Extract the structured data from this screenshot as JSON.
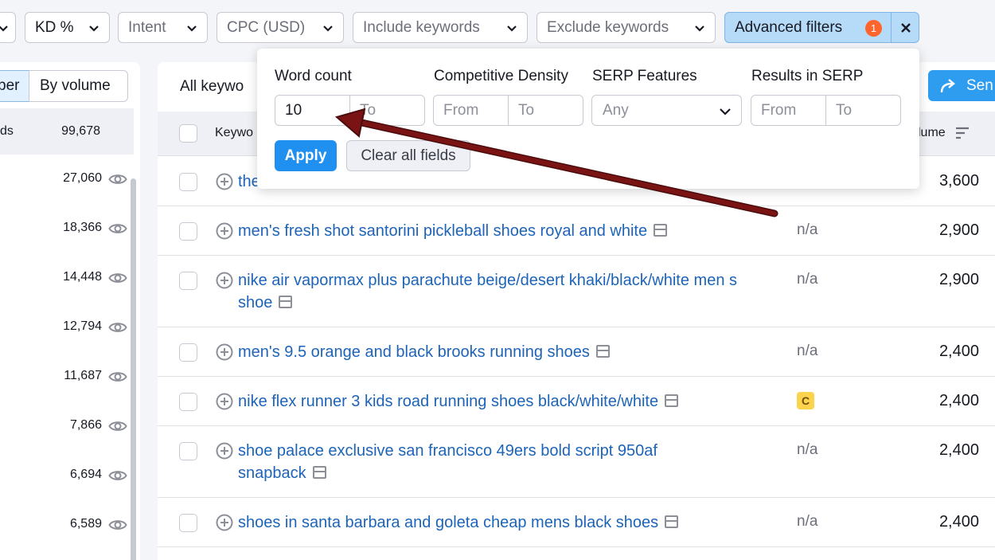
{
  "filters": {
    "partial": "",
    "kd": "KD %",
    "intent": "Intent",
    "cpc": "CPC (USD)",
    "include": "Include keywords",
    "exclude": "Exclude keywords",
    "advanced": "Advanced filters",
    "advanced_count": "1"
  },
  "left_panel": {
    "seg_a": "ber",
    "seg_b": "By volume",
    "header_label": "ds",
    "header_count": "99,678",
    "counts": [
      "27,060",
      "18,366",
      "14,448",
      "12,794",
      "11,687",
      "7,866",
      "6,694",
      "6,589"
    ]
  },
  "main": {
    "tab_label": "All keywo",
    "send_label": "Sen",
    "col_keyword": "Keywo",
    "col_volume": "lume"
  },
  "rows": [
    {
      "keyword": "the",
      "intent": "",
      "volume": "3,600"
    },
    {
      "keyword": "men's fresh shot santorini pickleball shoes royal and white",
      "intent": "n/a",
      "volume": "2,900"
    },
    {
      "keyword": "nike air vapormax plus parachute beige/desert khaki/black/white men s shoe",
      "intent": "n/a",
      "volume": "2,900"
    },
    {
      "keyword": "men's 9.5 orange and black brooks running shoes",
      "intent": "n/a",
      "volume": "2,400"
    },
    {
      "keyword": "nike flex runner 3 kids road running shoes black/white/white",
      "intent": "C",
      "volume": "2,400"
    },
    {
      "keyword": "shoe palace exclusive san francisco 49ers bold script 950af snapback",
      "intent": "n/a",
      "volume": "2,400"
    },
    {
      "keyword": "shoes in santa barbara and goleta cheap mens black shoes",
      "intent": "n/a",
      "volume": "2,400"
    }
  ],
  "popup": {
    "word_count_label": "Word count",
    "word_count_from": "10",
    "word_count_to": "To",
    "comp_density_label": "Competitive Density",
    "comp_from": "From",
    "comp_to": "To",
    "serp_features_label": "SERP Features",
    "serp_any": "Any",
    "results_label": "Results in SERP",
    "results_from": "From",
    "results_to": "To",
    "apply": "Apply",
    "clear": "Clear all fields"
  },
  "colors": {
    "accent": "#1f8ff0",
    "link": "#1d64b8",
    "badge": "#ff642d",
    "annotation_arrow": "#7a1414"
  }
}
